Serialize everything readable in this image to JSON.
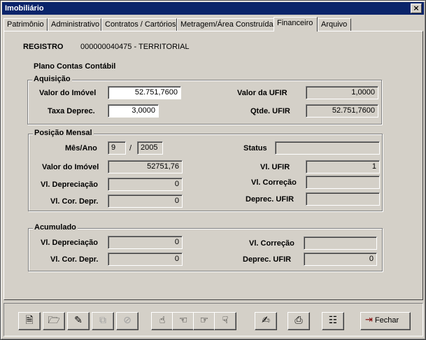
{
  "window": {
    "title": "Imobiliário",
    "close_glyph": "×"
  },
  "tabs": [
    {
      "label": "Patrimônio"
    },
    {
      "label": "Administrativo"
    },
    {
      "label": "Contratos / Cartórios"
    },
    {
      "label": "Metragem/Área Construída"
    },
    {
      "label": "Financeiro"
    },
    {
      "label": "Arquivo"
    }
  ],
  "active_tab": "Financeiro",
  "registro": {
    "label": "REGISTRO",
    "value": "000000040475 - TERRITORIAL"
  },
  "plano_contas": {
    "label": "Plano Contas Contábil"
  },
  "aquisicao": {
    "title": "Aquisição",
    "valor_imovel": {
      "label": "Valor do Imóvel",
      "value": "52.751,7600"
    },
    "taxa_deprec": {
      "label": "Taxa Deprec.",
      "value": "3,0000"
    },
    "valor_ufir": {
      "label": "Valor da UFIR",
      "value": "1,0000"
    },
    "qtde_ufir": {
      "label": "Qtde. UFIR",
      "value": "52.751,7600"
    }
  },
  "posicao_mensal": {
    "title": "Posição Mensal",
    "mes_ano": {
      "label": "Mês/Ano",
      "mes": "9",
      "sep": "/",
      "ano": "2005"
    },
    "status": {
      "label": "Status",
      "value": ""
    },
    "valor_imovel": {
      "label": "Valor do Imóvel",
      "value": "52751,76"
    },
    "vl_ufir": {
      "label": "Vl. UFIR",
      "value": "1"
    },
    "vl_depreciacao": {
      "label": "Vl. Depreciação",
      "value": "0"
    },
    "vl_correcao": {
      "label": "Vl. Correção",
      "value": ""
    },
    "vl_cor_depr": {
      "label": "Vl. Cor. Depr.",
      "value": "0"
    },
    "deprec_ufir": {
      "label": "Deprec. UFIR",
      "value": ""
    }
  },
  "acumulado": {
    "title": "Acumulado",
    "vl_depreciacao": {
      "label": "Vl. Depreciação",
      "value": "0"
    },
    "vl_correcao": {
      "label": "Vl. Correção",
      "value": ""
    },
    "vl_cor_depr": {
      "label": "Vl. Cor. Depr.",
      "value": "0"
    },
    "deprec_ufir": {
      "label": "Deprec. UFIR",
      "value": "0"
    }
  },
  "toolbar": {
    "buttons": [
      {
        "icon": "new-document-icon",
        "glyph": "🗎"
      },
      {
        "icon": "open-folder-icon",
        "glyph": "🗁"
      },
      {
        "icon": "edit-icon",
        "glyph": "✎"
      },
      {
        "icon": "copy-icon",
        "glyph": "⧉"
      },
      {
        "icon": "delete-icon",
        "glyph": "⊘"
      },
      {
        "icon": "first-record-icon",
        "glyph": "☝"
      },
      {
        "icon": "previous-record-icon",
        "glyph": "☜"
      },
      {
        "icon": "next-record-icon",
        "glyph": "☞"
      },
      {
        "icon": "last-record-icon",
        "glyph": "☟"
      },
      {
        "icon": "notes-icon",
        "glyph": "✍"
      },
      {
        "icon": "print-icon",
        "glyph": "⎙"
      },
      {
        "icon": "filter-icon",
        "glyph": "☷"
      }
    ],
    "fechar_label": "Fechar",
    "fechar_icon": "exit-door-icon",
    "fechar_glyph": "⇥"
  }
}
